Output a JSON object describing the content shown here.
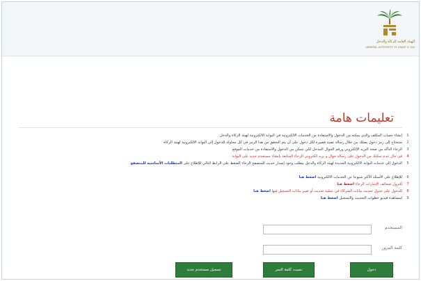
{
  "colors": {
    "title": "#c0392b",
    "button": "#2e7d3a",
    "link_blue": "#1a37c8",
    "link_red": "#d01818",
    "alert": "#e02020"
  },
  "header": {
    "logo_icon": "palm-tree-logo-icon",
    "logo_text": "زكاة ودخل",
    "org_name_ar": "الهيئة العامة للزكاة والدخل",
    "org_name_en": "GENERAL AUTHORITY OF ZAKAT & TAX"
  },
  "page": {
    "title": "تعليمات هامة"
  },
  "instructions": [
    {
      "num": "1",
      "text": "إنشاء حساب المكلف والذي يمكنه من الدخول والاستفادة من الخدمات الالكترونية في البوابة الالكترونية لهيئة الزكاة والدخل"
    },
    {
      "num": "2",
      "text": "ستحتاج إلى رمز دخول يصلك من خلال رسالة نصية قصيرة لكل دخول على أن يتم التحقق من هذا الرمز في كل محاولة للدخول إلى البوابة الالكترونية لهيئة الزكاة"
    },
    {
      "num": "3",
      "text": "الرجاء التأكد من صحة البريد الإلكتروني ورقم الجوال المدخل لكي تتمكن من الدخول والاستفادة من خدمات الموقع"
    },
    {
      "num": "4",
      "text": "في حال عدم تمكنك من الدخول على رسالة جوال و بريد الكتروني الرجاء المتابعة بإنشاء مستخدم جديد على البوابة"
    },
    {
      "num": "5",
      "text": "الدخول إلى خدمات البوابة الالكترونية الجديدة لهيئة الزكاة والدخل يتطلب وجود إصدار حديث للمتصفح الرجاء الضغط على الرابط التالي للإطلاع على",
      "link": "المتطلبات الأساسية",
      "cont": "للمتصفح"
    },
    {
      "num": "6",
      "text": "للإطلاع على الأسئلة الأكثر شيوعا عن الخدمات الالكترونية",
      "link": "اضغط هنا"
    },
    {
      "num": "7",
      "text": "للتزول صحائف الإشارات الرجاء",
      "link": "اضغط هنا"
    },
    {
      "num": "8",
      "text": "للدخول على جدول تحديث بيانات الشركاء في عملية تحديث أو تغيير بيانات التسجيل فيها",
      "link": "اضغط هنا"
    },
    {
      "num": "9",
      "text": "لمشاهدة فيديو خطوات التحديث والتسجيل",
      "link": "اضغط هنا"
    }
  ],
  "login": {
    "username_label": "المستخدم",
    "username_value": "",
    "password_label": "كلمة المرور",
    "password_value": "",
    "login_button": "دخول",
    "forgot_button": "نسيت كلمة السر",
    "register_button": "تسجيل مستخدم جديد"
  }
}
